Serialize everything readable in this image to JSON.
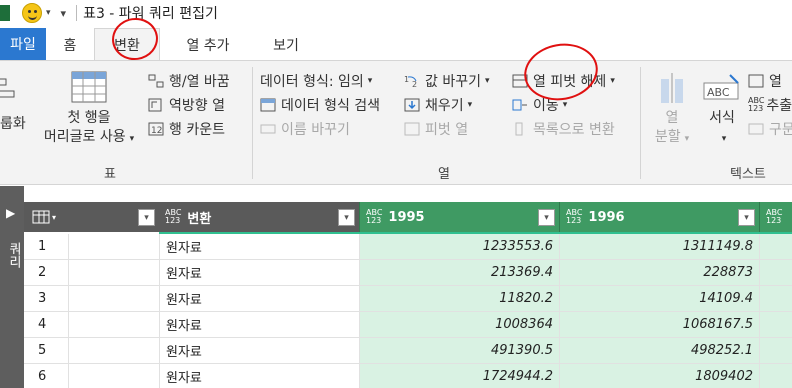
{
  "title_bar": {
    "title": "표3 - 파워 쿼리 편집기"
  },
  "tabs": [
    {
      "label": "파일"
    },
    {
      "label": "홈"
    },
    {
      "label": "변환"
    },
    {
      "label": "열 추가"
    },
    {
      "label": "보기"
    }
  ],
  "ribbon": {
    "table_group": {
      "label": "표",
      "group_by_label": "룹화",
      "first_row_label_line1": "첫 행을",
      "first_row_label_line2": "머리글로 사용",
      "transpose_label": "행/열 바꿈",
      "reverse_rows_label": "역방향 열",
      "count_rows_label": "행 카운트"
    },
    "column_group": {
      "label": "열",
      "data_type_label": "데이터 형식: 임의",
      "detect_type_label": "데이터 형식 검색",
      "rename_label": "이름 바꾸기",
      "replace_values_label": "값 바꾸기",
      "fill_label": "채우기",
      "pivot_label": "피벗 열",
      "unpivot_label": "열 피벗 해제",
      "move_label": "이동",
      "to_list_label": "목록으로 변환"
    },
    "text_group": {
      "label": "텍스트",
      "split_line1": "열",
      "split_line2": "분할",
      "format_label": "서식",
      "merge_label": "열",
      "extract_label": "추출",
      "parse_label": "구문"
    }
  },
  "leftnav": {
    "label": "쿼리"
  },
  "grid": {
    "columns": [
      {
        "type": "ABC\n123",
        "name": "변환"
      },
      {
        "type": "ABC\n123",
        "name": "1995"
      },
      {
        "type": "ABC\n123",
        "name": "1996"
      }
    ],
    "rows": [
      {
        "num": "1",
        "변환": "원자료",
        "c1995": "1233553.6",
        "c1996": "1311149.8"
      },
      {
        "num": "2",
        "변환": "원자료",
        "c1995": "213369.4",
        "c1996": "228873"
      },
      {
        "num": "3",
        "변환": "원자료",
        "c1995": "11820.2",
        "c1996": "14109.4"
      },
      {
        "num": "4",
        "변환": "원자료",
        "c1995": "1008364",
        "c1996": "1068167.5"
      },
      {
        "num": "5",
        "변환": "원자료",
        "c1995": "491390.5",
        "c1996": "498252.1"
      },
      {
        "num": "6",
        "변환": "원자료",
        "c1995": "1724944.2",
        "c1996": "1809402"
      }
    ]
  },
  "colors": {
    "file_tab": "#2b78d0",
    "header_green": "#3f9a63",
    "cell_green": "#d9f2e3",
    "annotation": "#e01010"
  },
  "icons": [
    "smiley-icon",
    "table-icon",
    "data-type-icon",
    "fill-down-icon",
    "move-icon",
    "pivot-icon",
    "unpivot-icon",
    "split-column-icon",
    "format-icon"
  ]
}
